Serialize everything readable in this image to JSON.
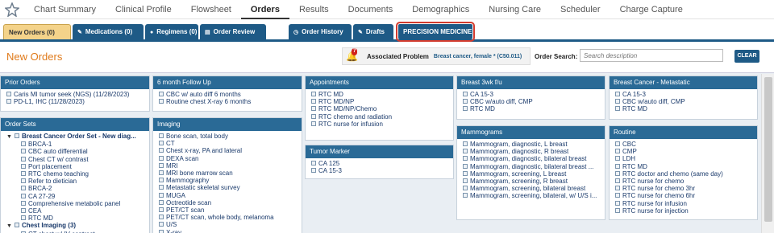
{
  "nav": {
    "tabs": [
      "Chart Summary",
      "Clinical Profile",
      "Flowsheet",
      "Orders",
      "Results",
      "Documents",
      "Demographics",
      "Nursing Care",
      "Scheduler",
      "Charge Capture"
    ],
    "active": "Orders"
  },
  "subtabs": {
    "new_orders": "New Orders (0)",
    "medications": "Medications (0)",
    "regimens": "Regimens (0)",
    "order_review": "Order Review",
    "order_history": "Order History",
    "drafts": "Drafts",
    "precision": "PRECISION MEDICINE"
  },
  "header": {
    "title": "New Orders",
    "bell_count": "7",
    "assoc_label": "Associated Problem",
    "assoc_value": "Breast cancer, female * (C50.011)",
    "search_label": "Order Search:",
    "search_placeholder": "Search description",
    "clear": "CLEAR"
  },
  "panels": {
    "prior_orders": {
      "title": "Prior Orders",
      "items": [
        "Caris MI tumor seek (NGS) (11/28/2023)",
        "PD-L1, IHC (11/28/2023)"
      ]
    },
    "six_month": {
      "title": "6 month Follow Up",
      "items": [
        "CBC w/ auto diff 6 months",
        "Routine chest X-ray 6 months"
      ]
    },
    "appointments": {
      "title": "Appointments",
      "items": [
        "RTC MD",
        "RTC MD/NP",
        "RTC MD/NP/Chemo",
        "RTC chemo and radiation",
        "RTC nurse for infusion"
      ]
    },
    "breast_3wk": {
      "title": "Breast 3wk f/u",
      "items": [
        "CA 15-3",
        "CBC w/auto diff, CMP",
        "RTC MD"
      ]
    },
    "breast_meta": {
      "title": "Breast Cancer - Metastatic",
      "items": [
        "CA 15-3",
        "CBC w/auto diff, CMP",
        "RTC MD"
      ]
    },
    "order_sets": {
      "title": "Order Sets",
      "set1": "Breast Cancer Order Set - New diag...",
      "set1_items": [
        "BRCA-1",
        "CBC auto differential",
        "Chest CT w/ contrast",
        "Port placement",
        "RTC chemo teaching",
        "Refer to dietician",
        "BRCA-2",
        "CA 27-29",
        "Comprehensive metabolic panel",
        "CEA",
        "RTC MD"
      ],
      "set2": "Chest Imaging (3)",
      "set2_items": [
        "CT chest w/ IV contrast"
      ]
    },
    "imaging": {
      "title": "Imaging",
      "items": [
        "Bone scan, total body",
        "CT",
        "Chest x-ray, PA and lateral",
        "DEXA scan",
        "MRI",
        "MRI bone marrow scan",
        "Mammography",
        "Metastatic skeletal survey",
        "MUGA",
        "Octreotide scan",
        "PET/CT scan",
        "PET/CT scan, whole body, melanoma",
        "U/S",
        "X-ray"
      ]
    },
    "tumor_marker": {
      "title": "Tumor Marker",
      "items": [
        "CA 125",
        "CA 15-3"
      ]
    },
    "mammograms": {
      "title": "Mammograms",
      "items": [
        "Mammogram, diagnostic, L breast",
        "Mammogram, diagnostic, R breast",
        "Mammogram, diagnostic, bilateral breast",
        "Mammogram, diagnostic, bilateral breast ...",
        "Mammogram, screening, L breast",
        "Mammogram, screening, R breast",
        "Mammogram, screening, bilateral breast",
        "Mammogram, screening, bilateral, w/ U/S i..."
      ]
    },
    "routine": {
      "title": "Routine",
      "items": [
        "CBC",
        "CMP",
        "LDH",
        "RTC MD",
        "RTC doctor and chemo (same day)",
        "RTC nurse for chemo",
        "RTC nurse for chemo 3hr",
        "RTC nurse for chemo 6hr",
        "RTC nurse for infusion",
        "RTC nurse for injection"
      ]
    }
  }
}
